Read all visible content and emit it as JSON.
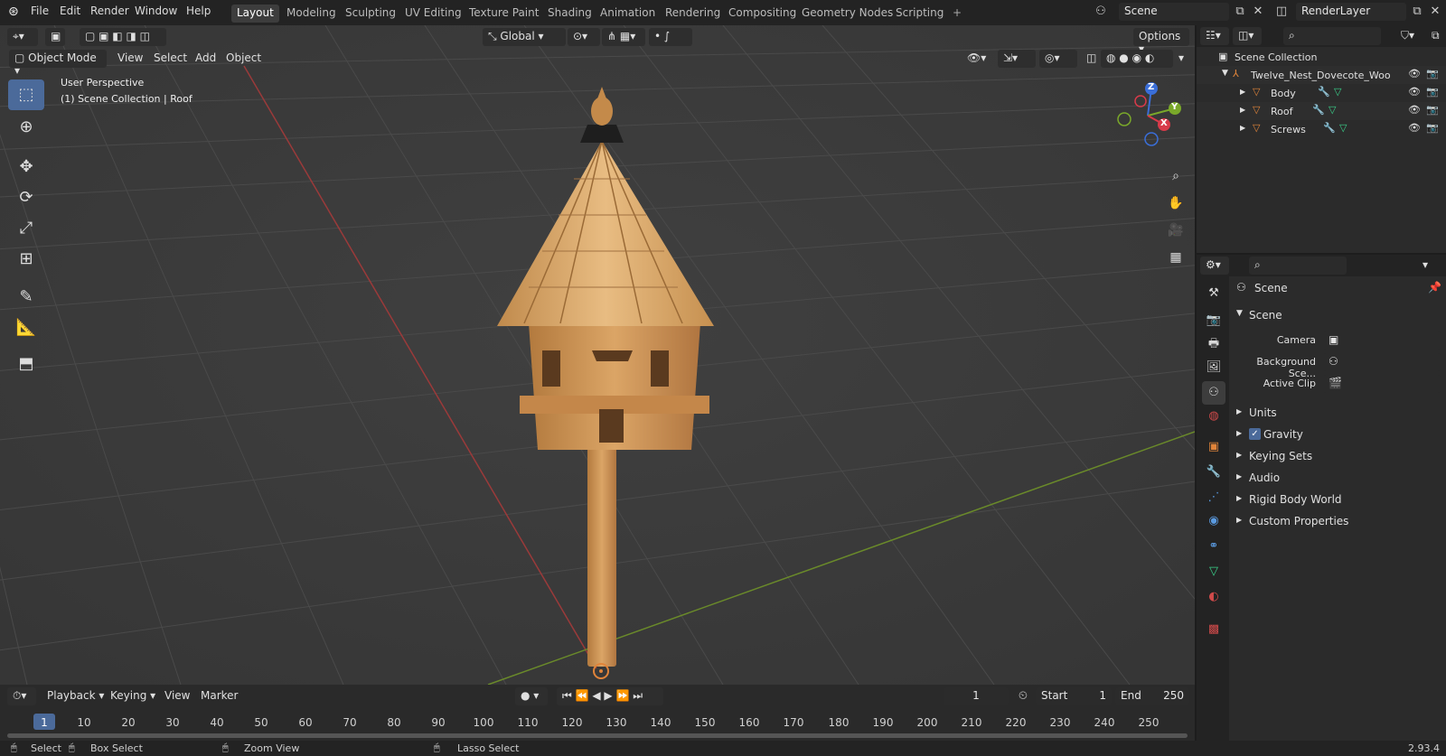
{
  "topbar": {
    "menus": [
      "File",
      "Edit",
      "Render",
      "Window",
      "Help"
    ],
    "workspaces": [
      "Layout",
      "Modeling",
      "Sculpting",
      "UV Editing",
      "Texture Paint",
      "Shading",
      "Animation",
      "Rendering",
      "Compositing",
      "Geometry Nodes",
      "Scripting"
    ],
    "active_workspace": "Layout",
    "scene_name": "Scene",
    "view_layer": "RenderLayer"
  },
  "viewport": {
    "mode": "Object Mode",
    "menus": [
      "View",
      "Select",
      "Add",
      "Object"
    ],
    "transform_orientation": "Global",
    "options_label": "Options",
    "overlay_title": "User Perspective",
    "overlay_subtitle": "(1) Scene Collection | Roof"
  },
  "gizmo": {
    "z_label": "Z",
    "y_label": "Y",
    "x_label": "X"
  },
  "outliner": {
    "root": "Scene Collection",
    "collection": "Twelve_Nest_Dovecote_Woo",
    "objects": [
      "Body",
      "Roof",
      "Screws"
    ]
  },
  "properties": {
    "context": "Scene",
    "panel_title": "Scene",
    "fields": [
      {
        "label": "Camera",
        "value": ""
      },
      {
        "label": "Background Sce...",
        "value": ""
      },
      {
        "label": "Active Clip",
        "value": ""
      }
    ],
    "subpanels": [
      "Units",
      "Gravity",
      "Keying Sets",
      "Audio",
      "Rigid Body World",
      "Custom Properties"
    ],
    "gravity_checked": true
  },
  "timeline": {
    "menus": [
      "Playback",
      "Keying",
      "View",
      "Marker"
    ],
    "current_frame": "1",
    "start_label": "Start",
    "start_value": "1",
    "end_label": "End",
    "end_value": "250",
    "ticks": [
      "1",
      "10",
      "20",
      "30",
      "40",
      "50",
      "60",
      "70",
      "80",
      "90",
      "100",
      "110",
      "120",
      "130",
      "140",
      "150",
      "160",
      "170",
      "180",
      "190",
      "200",
      "210",
      "220",
      "230",
      "240",
      "250"
    ]
  },
  "statusbar": {
    "select": "Select",
    "box_select": "Box Select",
    "zoom_view": "Zoom View",
    "lasso_select": "Lasso Select",
    "version": "2.93.4"
  },
  "colors": {
    "accent": "#4b6a9a",
    "header": "#232323",
    "viewport": "#3d3d3d",
    "panel": "#2b2b2b"
  }
}
